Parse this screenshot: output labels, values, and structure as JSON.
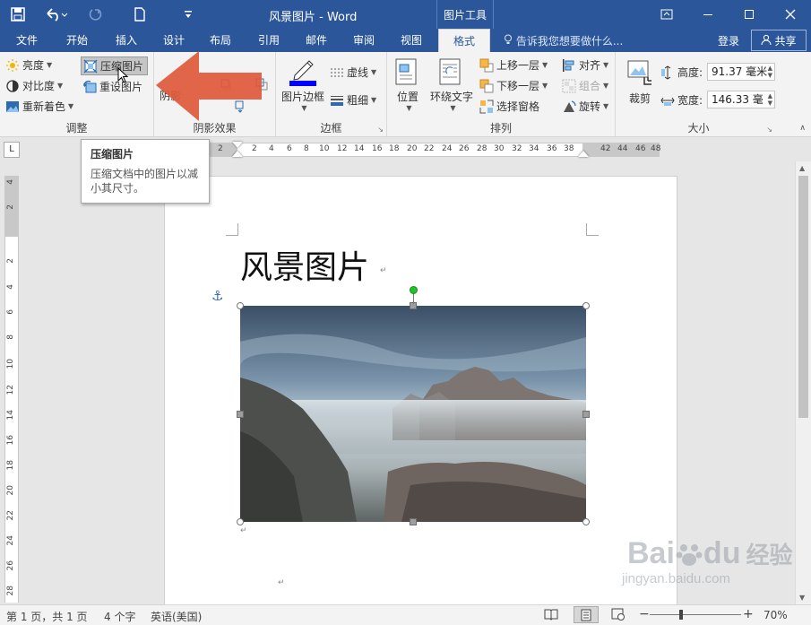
{
  "app": {
    "title": "风景图片 - Word",
    "context_tab": "图片工具",
    "qat_icons": [
      "save-icon",
      "undo-icon",
      "redo-icon",
      "new-document-icon",
      "customize-qat-icon"
    ],
    "window_controls": [
      "ribbon-display-icon",
      "minimize-icon",
      "maximize-icon",
      "close-icon"
    ]
  },
  "tabs": {
    "items": [
      "文件",
      "开始",
      "插入",
      "设计",
      "布局",
      "引用",
      "邮件",
      "审阅",
      "视图",
      "格式"
    ],
    "active": "格式",
    "tell_me": "告诉我您想要做什么...",
    "login": "登录",
    "share": "共享"
  },
  "ribbon": {
    "adjust": {
      "label": "调整",
      "brightness": "亮度",
      "contrast": "对比度",
      "recolor": "重新着色",
      "compress": "压缩图片",
      "reset": "重设图片"
    },
    "shadow": {
      "label": "阴影效果",
      "shadow_btn": "阴影"
    },
    "border": {
      "label": "边框",
      "picture_border": "图片边框",
      "dashes": "虚线",
      "weight": "粗细",
      "border_color": "#0000ff"
    },
    "arrange": {
      "label": "排列",
      "position": "位置",
      "wrap_text": "环绕文字",
      "bring_forward": "上移一层",
      "send_backward": "下移一层",
      "selection_pane": "选择窗格",
      "align": "对齐",
      "group": "组合",
      "rotate": "旋转"
    },
    "size": {
      "label": "大小",
      "crop": "裁剪",
      "height_label": "高度:",
      "height_value": "91.37 毫米",
      "width_label": "宽度:",
      "width_value": "146.33 毫"
    }
  },
  "tooltip": {
    "title": "压缩图片",
    "body": "压缩文档中的图片以减小其尺寸。"
  },
  "ruler": {
    "tab_selector": "L",
    "h_left_numbers": [
      "2"
    ],
    "h_numbers": [
      "2",
      "4",
      "6",
      "8",
      "10",
      "12",
      "14",
      "16",
      "18",
      "20",
      "22",
      "24",
      "26",
      "28",
      "30",
      "32",
      "34",
      "36",
      "38"
    ],
    "h_right_numbers": [
      "42",
      "44",
      "46",
      "48"
    ],
    "v_top_numbers": [
      "4",
      "2"
    ],
    "v_numbers": [
      "2",
      "4",
      "6",
      "8",
      "10",
      "12",
      "14",
      "16",
      "18",
      "20",
      "22",
      "24",
      "26",
      "28"
    ]
  },
  "document": {
    "heading": "风景图片",
    "para_mark": "↵",
    "anchor_icon": "anchor-icon"
  },
  "status": {
    "page": "第 1 页，共 1 页",
    "words": "4 个字",
    "language": "英语(美国)",
    "zoom": "70%",
    "zoom_percent": 70,
    "view_icons": [
      "read-mode-icon",
      "print-layout-icon",
      "web-layout-icon"
    ]
  },
  "watermark": {
    "brand": "Bai",
    "paw": "du",
    "cn": "经验",
    "url": "jingyan.baidu.com"
  }
}
